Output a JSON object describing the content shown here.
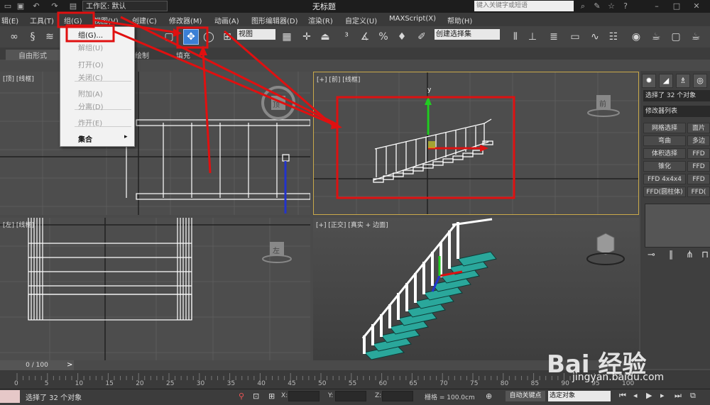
{
  "titlebar": {
    "workspace": "工作区: 默认",
    "title": "无标题",
    "search_placeholder": "键入关键字或短语"
  },
  "menubar": {
    "items": [
      "辑(E)",
      "工具(T)",
      "组(G)",
      "视图(V)",
      "创建(C)",
      "修改器(M)",
      "动画(A)",
      "图形编辑器(D)",
      "渲染(R)",
      "自定义(U)",
      "MAXScript(X)",
      "帮助(H)"
    ]
  },
  "toolbar": {
    "view_select": "视图",
    "selection_set": "创建选择集"
  },
  "ribbon": {
    "tabs": [
      "自由形式",
      "绘制",
      "填充"
    ]
  },
  "group_menu": {
    "items": [
      {
        "label": "组(G)...",
        "enabled": true
      },
      {
        "label": "解组(U)",
        "enabled": false
      },
      {
        "label": "打开(O)",
        "enabled": false
      },
      {
        "label": "关闭(C)",
        "enabled": false
      },
      {
        "label": "附加(A)",
        "enabled": false
      },
      {
        "label": "分离(D)",
        "enabled": false
      },
      {
        "label": "炸开(E)",
        "enabled": false
      },
      {
        "label": "集合",
        "enabled": true
      }
    ]
  },
  "viewports": {
    "top_label": "[顶] [线框]",
    "front_label": "[+] [前] [线框]",
    "left_label": "[左] [线框]",
    "persp_label": "[+] [正交] [真实 + 边面]",
    "cube_top": "顶",
    "cube_front": "前",
    "cube_left": "左"
  },
  "command_panel": {
    "selection_info": "选择了 32 个对象",
    "modifier_list": "修改器列表",
    "buttons": [
      [
        "网格选择",
        "面片"
      ],
      [
        "弯曲",
        "多边"
      ],
      [
        "体积选择",
        "FFD"
      ],
      [
        "锥化",
        "FFD"
      ],
      [
        "FFD 4x4x4",
        "FFD"
      ],
      [
        "FFD(圆柱体)",
        "FFD("
      ]
    ]
  },
  "timeline": {
    "slider": "0 / 100",
    "ticks": [
      "0",
      "5",
      "10",
      "15",
      "20",
      "25",
      "30",
      "35",
      "40",
      "45",
      "50",
      "55",
      "60",
      "65",
      "70",
      "75",
      "80",
      "85",
      "90",
      "95",
      "100"
    ]
  },
  "statusbar": {
    "status": "选择了 32 个对象",
    "x_label": "X:",
    "y_label": "Y:",
    "z_label": "Z:",
    "grid": "栅格 = 100.0cm",
    "autokey": "自动关键点",
    "select_object": "选定对象"
  },
  "watermark": {
    "logo": "Bai 经验",
    "url": "jingyan.baidu.com"
  },
  "colors": {
    "annotation_red": "#e01010",
    "active_tool_blue": "#3a7fd5",
    "stair_teal": "#2aa79b"
  }
}
